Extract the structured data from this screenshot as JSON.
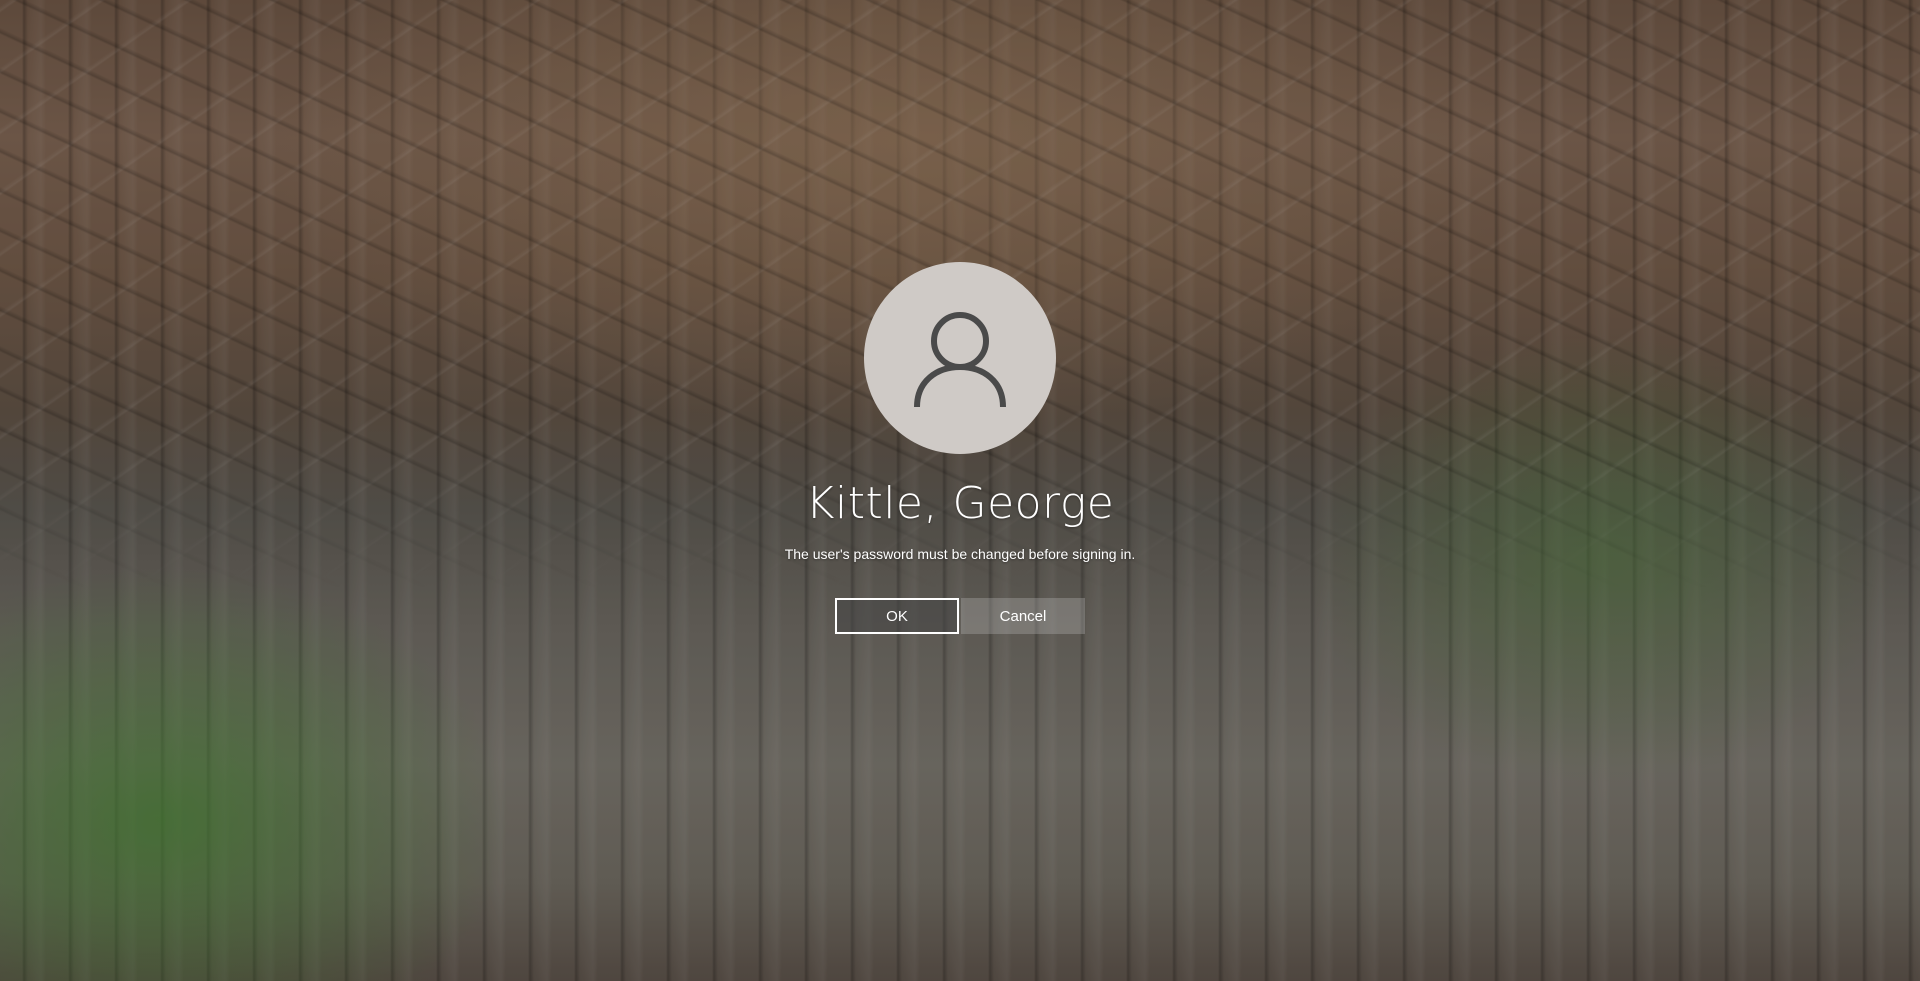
{
  "user": {
    "name": "Kittle, George",
    "avatar_icon": "user-icon"
  },
  "message": "The user's password must be changed before signing in.",
  "buttons": {
    "ok_label": "OK",
    "cancel_label": "Cancel"
  },
  "colors": {
    "avatar_background": "#cfcac6",
    "avatar_glyph": "#4a4a4a",
    "text": "#ffffff"
  }
}
